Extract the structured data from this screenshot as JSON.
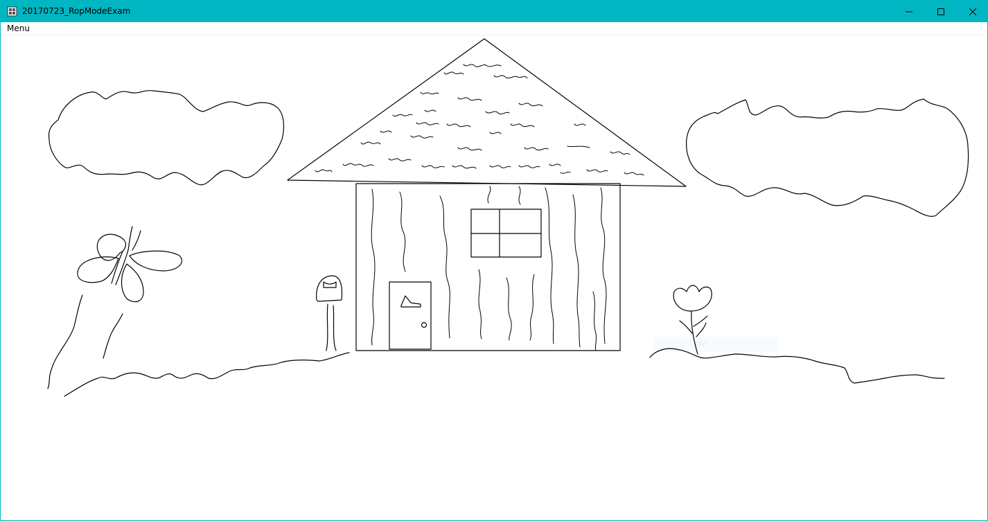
{
  "window": {
    "title": "20170723_RopModeExam",
    "accent_color": "#00b6c3",
    "icon": "app-icon",
    "controls": {
      "minimize_icon": "minimize-icon",
      "maximize_icon": "maximize-icon",
      "close_icon": "close-icon"
    }
  },
  "menubar": {
    "items": [
      {
        "label": "Menu"
      }
    ]
  },
  "canvas": {
    "background": "#ffffff",
    "stroke_color": "#000000",
    "drawing_subjects": [
      "clouds",
      "house",
      "roof",
      "door",
      "window",
      "mailbox",
      "butterfly",
      "tree-trunk",
      "flower",
      "ground"
    ],
    "ghost_overlay_text": "(W)"
  }
}
